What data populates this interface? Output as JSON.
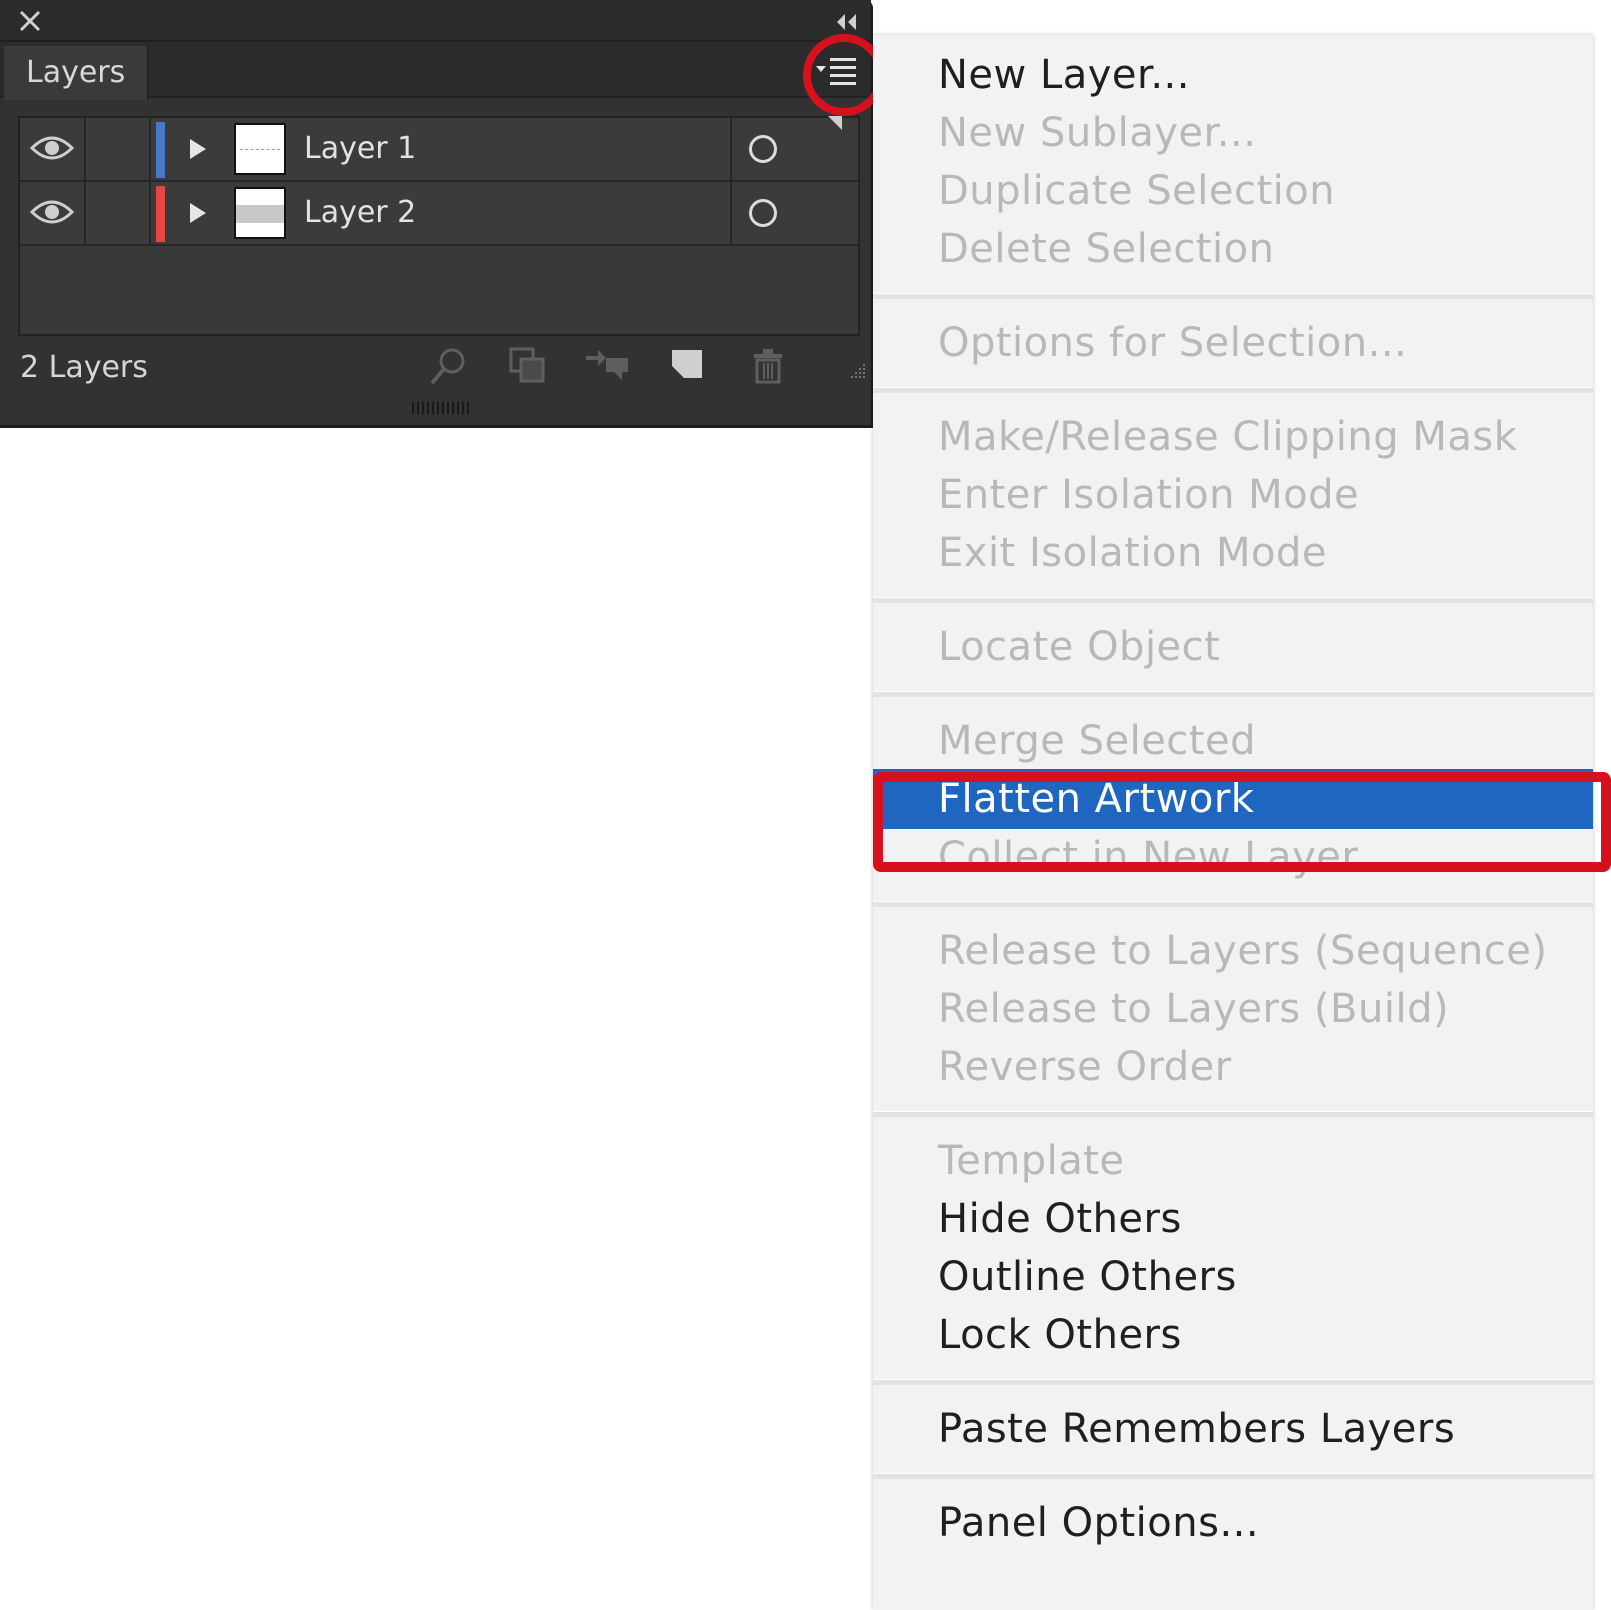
{
  "panel": {
    "tab_label": "Layers",
    "layers": [
      {
        "name": "Layer 1",
        "color": "#4a78c8"
      },
      {
        "name": "Layer 2",
        "color": "#e84545"
      }
    ],
    "layer_count": "2 Layers",
    "icons": [
      "close-icon",
      "collapse-icon",
      "panel-menu-icon",
      "eye-icon",
      "disclosure-arrow-icon",
      "target-circle-icon",
      "locate-object-icon",
      "make-clipping-mask-icon",
      "move-to-layer-icon",
      "new-layer-icon",
      "trash-icon"
    ]
  },
  "menu": {
    "items": [
      {
        "label": "New Layer...",
        "enabled": true
      },
      {
        "label": "New Sublayer...",
        "enabled": false
      },
      {
        "label": "Duplicate Selection",
        "enabled": false
      },
      {
        "label": "Delete Selection",
        "enabled": false
      },
      {
        "label": "Options for Selection...",
        "enabled": false
      },
      {
        "label": "Make/Release Clipping Mask",
        "enabled": false
      },
      {
        "label": "Enter Isolation Mode",
        "enabled": false
      },
      {
        "label": "Exit Isolation Mode",
        "enabled": false
      },
      {
        "label": "Locate Object",
        "enabled": false
      },
      {
        "label": "Merge Selected",
        "enabled": false
      },
      {
        "label": "Flatten Artwork",
        "enabled": true,
        "highlighted": true
      },
      {
        "label": "Collect in New Layer",
        "enabled": false
      },
      {
        "label": "Release to Layers (Sequence)",
        "enabled": false
      },
      {
        "label": "Release to Layers (Build)",
        "enabled": false
      },
      {
        "label": "Reverse Order",
        "enabled": false
      },
      {
        "label": "Template",
        "enabled": false
      },
      {
        "label": "Hide Others",
        "enabled": true
      },
      {
        "label": "Outline Others",
        "enabled": true
      },
      {
        "label": "Lock Others",
        "enabled": true
      },
      {
        "label": "Paste Remembers Layers",
        "enabled": true
      },
      {
        "label": "Panel Options...",
        "enabled": true
      }
    ]
  },
  "colors": {
    "highlight": "#1f66c0",
    "annotation_red": "#d6111d"
  }
}
